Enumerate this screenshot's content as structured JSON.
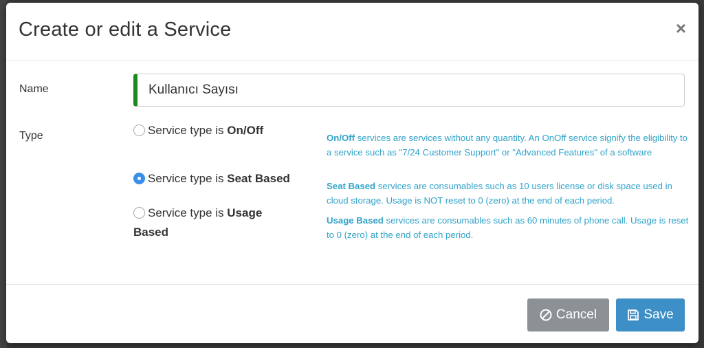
{
  "modal": {
    "title": "Create or edit a Service",
    "close_glyph": "×",
    "name_label": "Name",
    "name_value": "Kullanıcı Sayısı",
    "type_label": "Type",
    "options": [
      {
        "prefix": "Service type is ",
        "strong": "On/Off",
        "checked": false
      },
      {
        "prefix": "Service type is ",
        "strong": "Seat Based",
        "checked": true
      },
      {
        "prefix": "Service type is ",
        "strong": "Usage Based",
        "checked": false
      }
    ],
    "help": [
      {
        "strong": "On/Off",
        "text": " services are services without any quantity. An OnOff service signify the eligibility to a service such as \"7/24 Customer Support\" or \"Advanced Features\" of a software"
      },
      {
        "strong": "Seat Based",
        "text": " services are consumables such as 10 users license or disk space used in cloud storage. Usage is NOT reset to 0 (zero) at the end of each period."
      },
      {
        "strong": "Usage Based",
        "text": " services are consumables such as 60 minutes of phone call. Usage is reset to 0 (zero) at the end of each period."
      }
    ],
    "cancel_label": "Cancel",
    "save_label": "Save",
    "icons": {
      "cancel": "ban-icon",
      "save": "floppy-icon"
    },
    "colors": {
      "accent": "#3b8fe8",
      "help_text": "#31a3c9",
      "valid_border": "#1a8a1a",
      "cancel_bg": "#8c9196",
      "save_bg": "#3d8fc8"
    }
  }
}
